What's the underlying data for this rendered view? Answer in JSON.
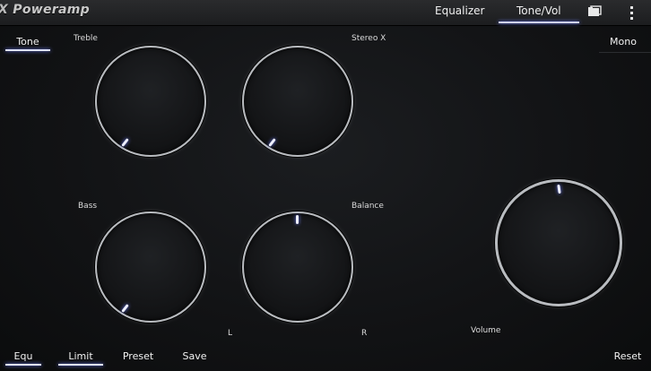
{
  "app": {
    "logo_text": "Poweramp",
    "logo_mark": "X"
  },
  "top_tabs": [
    {
      "label": "Equalizer"
    },
    {
      "label": "Tone/Vol"
    }
  ],
  "left_toggle": {
    "label": "Tone"
  },
  "right_toggle": {
    "label": "Mono"
  },
  "knobs": {
    "treble": {
      "label": "Treble"
    },
    "stereo": {
      "label": "Stereo X"
    },
    "bass": {
      "label": "Bass"
    },
    "balance": {
      "label": "Balance",
      "left": "L",
      "right": "R"
    },
    "volume": {
      "label": "Volume"
    }
  },
  "bottom_bar": {
    "equ": "Equ",
    "limit": "Limit",
    "preset": "Preset",
    "save": "Save",
    "reset": "Reset"
  },
  "colors": {
    "accent": "#7c8cff",
    "ring": "#b9bcc0"
  },
  "icons": {
    "folder": "folder-icon",
    "menu": "overflow-menu-icon"
  }
}
